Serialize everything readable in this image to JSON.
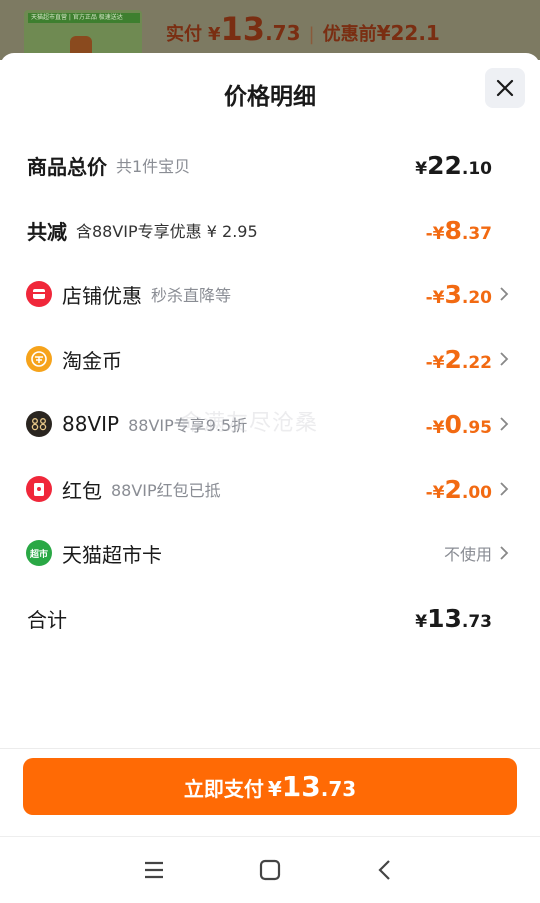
{
  "background": {
    "thumb_banner": "天猫超市直营 | 官方正品 极速送达",
    "paid_label": "实付",
    "paid_yen": "¥",
    "paid_int": "13",
    "paid_dec": ".73",
    "separator": "|",
    "before_label": "优惠前",
    "before_amount": "¥22.1"
  },
  "sheet": {
    "title": "价格明细",
    "rows": [
      {
        "label": "商品总价",
        "sub": "共1件宝贝",
        "prefix": "¥",
        "int": "22",
        "dec": ".10"
      },
      {
        "label": "共减",
        "sub": "含88VIP专享优惠 ¥ 2.95",
        "prefix": "-¥",
        "int": "8",
        "dec": ".37"
      },
      {
        "label": "店铺优惠",
        "sub": "秒杀直降等",
        "prefix": "-¥",
        "int": "3",
        "dec": ".20"
      },
      {
        "label": "淘金币",
        "sub": "",
        "prefix": "-¥",
        "int": "2",
        "dec": ".22"
      },
      {
        "label": "88VIP",
        "sub": "88VIP专享9.5折",
        "prefix": "-¥",
        "int": "0",
        "dec": ".95"
      },
      {
        "label": "红包",
        "sub": "88VIP红包已抵",
        "prefix": "-¥",
        "int": "2",
        "dec": ".00"
      },
      {
        "label": "天猫超市卡",
        "sub": "",
        "value": "不使用"
      },
      {
        "label": "合计",
        "sub": "",
        "prefix": "¥",
        "int": "13",
        "dec": ".73"
      }
    ],
    "watermark": "命满友尽沧桑"
  },
  "pay_button": {
    "label": "立即支付",
    "prefix": "¥",
    "int": "13",
    "dec": ".73"
  },
  "icons": {
    "shop": "shop-coupon-icon",
    "coin": "taojinbi-coin-icon",
    "vip": "88vip-icon",
    "redpacket": "red-packet-icon",
    "market": "tmall-supermarket-icon",
    "icon_market_text": "超市"
  },
  "colors": {
    "accent": "#ff6a05",
    "discount": "#f26a12",
    "shop_red": "#f0273a",
    "coin_gold": "#f6a31b",
    "market_green": "#2aa845"
  }
}
